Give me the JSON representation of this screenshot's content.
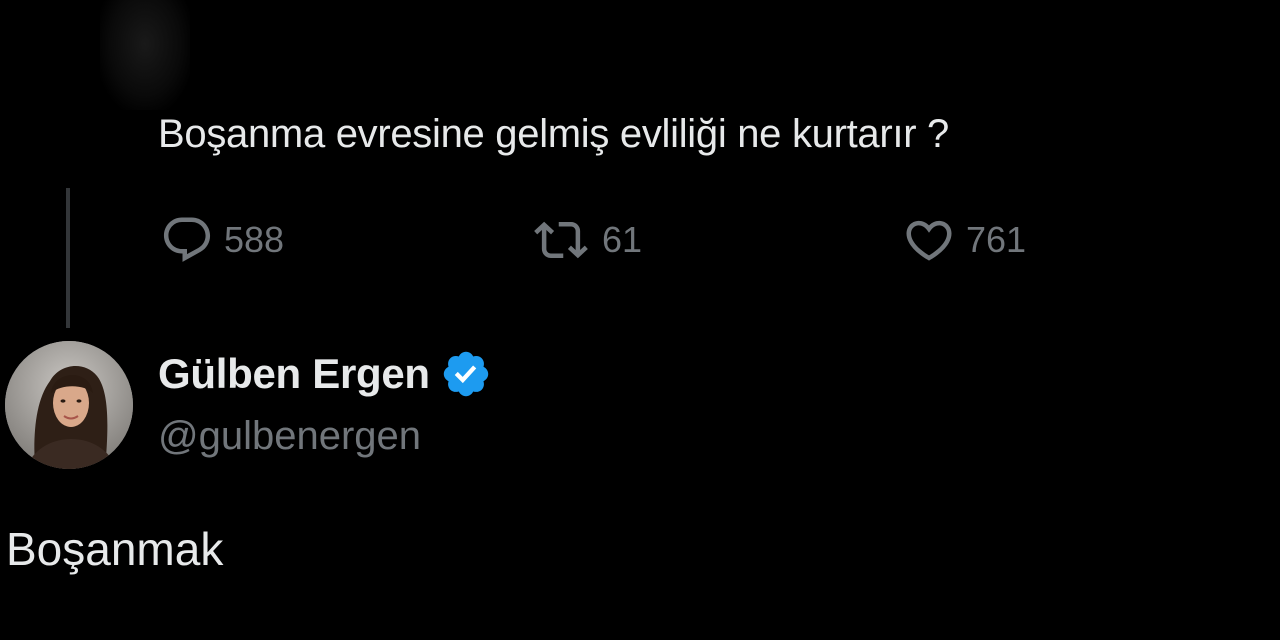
{
  "parent_tweet": {
    "text": "Boşanma evresine gelmiş evliliği ne kurtarır ?",
    "stats": {
      "replies": "588",
      "retweets": "61",
      "likes": "761"
    },
    "icons": {
      "reply": "reply-icon",
      "retweet": "retweet-icon",
      "like": "heart-icon"
    }
  },
  "reply_tweet": {
    "author": {
      "name": "Gülben Ergen",
      "handle": "@gulbenergen",
      "verified_icon": "verified-badge-icon",
      "avatar": "avatar"
    },
    "text": "Boşanmak"
  },
  "colors": {
    "background": "#000000",
    "primary_text": "#e7e9ea",
    "secondary_text": "#71767b",
    "thread_line": "#333639",
    "verified_blue": "#1d9bf0"
  }
}
